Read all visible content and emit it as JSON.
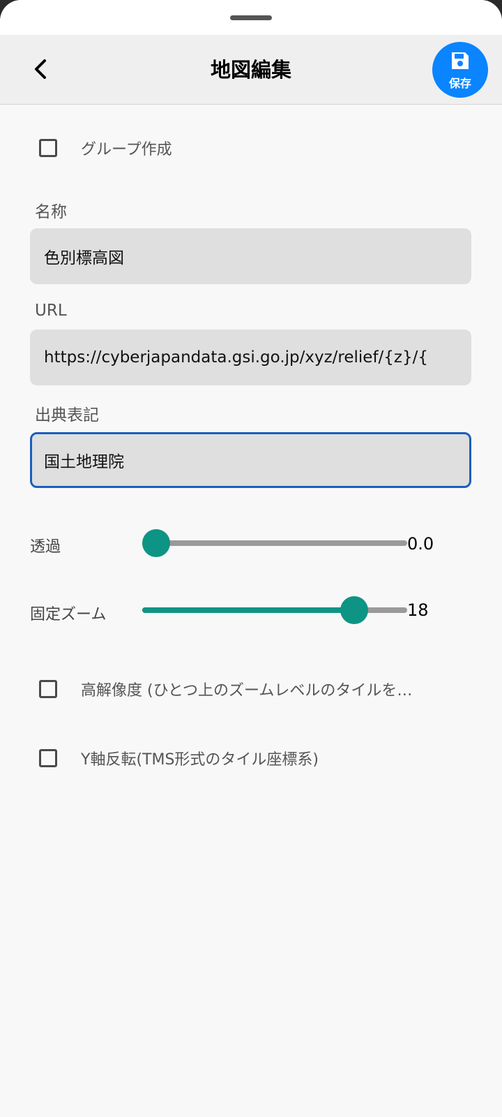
{
  "header": {
    "title": "地図編集",
    "save_label": "保存"
  },
  "group_checkbox": {
    "label": "グループ作成",
    "checked": false
  },
  "fields": {
    "name": {
      "label": "名称",
      "value": "色別標高図"
    },
    "url": {
      "label": "URL",
      "value": "https://cyberjapandata.gsi.go.jp/xyz/relief/{z}/{"
    },
    "attribution": {
      "label": "出典表記",
      "value": "国土地理院"
    }
  },
  "sliders": {
    "opacity": {
      "label": "透過",
      "value_text": "0.0",
      "fraction": 0.0
    },
    "fixed_zoom": {
      "label": "固定ズーム",
      "value_text": "18",
      "fraction": 0.79
    }
  },
  "hires_checkbox": {
    "label": "高解像度 (ひとつ上のズームレベルのタイルを…",
    "checked": false
  },
  "yflip_checkbox": {
    "label": "Y軸反転(TMS形式のタイル座標系)",
    "checked": false
  },
  "colors": {
    "accent": "#0e9484",
    "save_button": "#0a84ff",
    "focus_border": "#1a5fbf"
  }
}
